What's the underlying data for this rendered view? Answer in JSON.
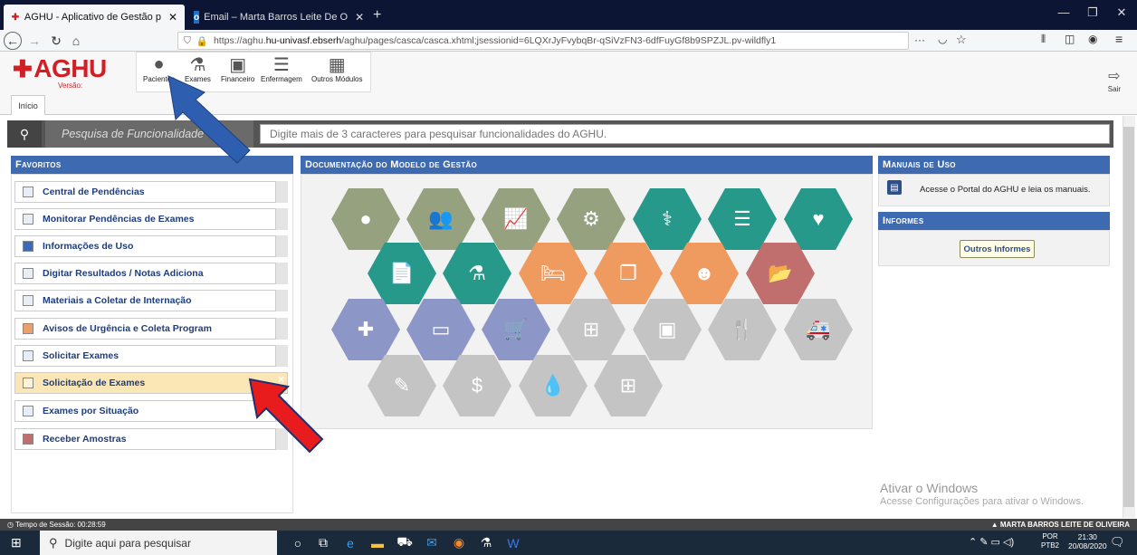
{
  "browser": {
    "tabs": [
      {
        "title": "AGHU - Aplicativo de Gestão p",
        "active": true
      },
      {
        "title": "Email – Marta Barros Leite De O",
        "active": false
      }
    ],
    "new_tab": "+",
    "url_prefix": "https://aghu.",
    "url_domain": "hu-univasf.ebserh",
    "url_rest": "/aghu/pages/casca/casca.xhtml;jsessionid=6LQXrJyFvybqBr-qSiVzFN3-6dfFuyGf8b9SPZJL.pv-wildfly1",
    "menu_dots": "···"
  },
  "app": {
    "logo": "AGHU",
    "version_label": "Versão:",
    "modules": [
      {
        "label": "Pacientes",
        "icon": "person-icon"
      },
      {
        "label": "Exames",
        "icon": "flask-icon"
      },
      {
        "label": "Financeiro",
        "icon": "money-icon"
      },
      {
        "label": "Enfermagem",
        "icon": "list-icon"
      },
      {
        "label": "Outros Módulos",
        "icon": "grid-icon"
      }
    ],
    "exit_label": "Sair",
    "home_tab": "Início"
  },
  "search": {
    "label": "Pesquisa de Funcionalidade",
    "placeholder": "Digite mais de 3 caracteres para pesquisar funcionalidades do AGHU."
  },
  "favorites": {
    "title": "Favoritos",
    "items": [
      {
        "label": "Central de Pendências"
      },
      {
        "label": "Monitorar Pendências de Exames"
      },
      {
        "label": "Informações de Uso"
      },
      {
        "label": "Digitar Resultados / Notas Adiciona"
      },
      {
        "label": "Materiais a Coletar de Internação"
      },
      {
        "label": "Avisos de Urgência e Coleta Program"
      },
      {
        "label": "Solicitar Exames"
      },
      {
        "label": "Solicitação de Exames",
        "selected": true
      },
      {
        "label": "Exames por Situação"
      },
      {
        "label": "Receber Amostras"
      }
    ]
  },
  "documentation": {
    "title": "Documentação do Modelo de Gestão"
  },
  "manuals": {
    "title": "Manuais de Uso",
    "text": "Acesse o Portal do AGHU e leia os manuais."
  },
  "informes": {
    "title": "Informes",
    "button": "Outros Informes"
  },
  "watermark": {
    "title": "Ativar o Windows",
    "subtitle": "Acesse Configurações para ativar o Windows."
  },
  "status": {
    "session": "Tempo de Sessão: 00:28:59",
    "user": "MARTA BARROS LEITE DE OLIVEIRA"
  },
  "taskbar": {
    "search_placeholder": "Digite aqui para pesquisar",
    "lang": "POR",
    "lang2": "PTB2",
    "time": "21:30",
    "date": "20/08/2020"
  }
}
